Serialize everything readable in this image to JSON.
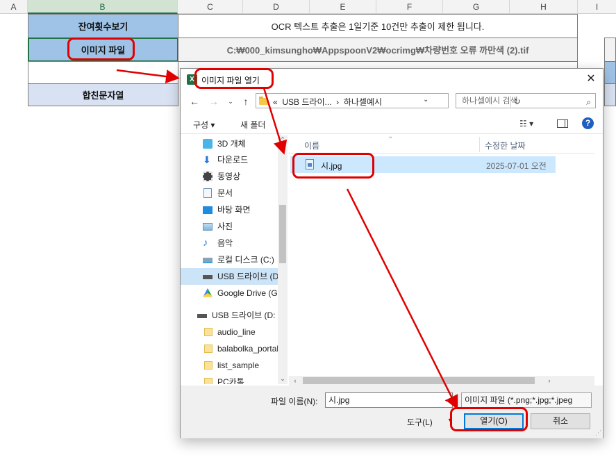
{
  "sheet": {
    "columns": [
      "A",
      "B",
      "C",
      "D",
      "E",
      "F",
      "G",
      "H",
      "I"
    ],
    "selected_column": "B",
    "rows": {
      "r1_label": "잔여횟수보기",
      "r1_value": "OCR 텍스트 추출은 1일기준 10건만 추출이 제한 됩니다.",
      "r2_label": "이미지 파일",
      "r2_value": "C:₩000_kimsungho₩AppspoonV2₩ocrimg₩차량번호 오류 까만색 (2).tif",
      "r4_label": "합친문자열"
    }
  },
  "dialog": {
    "title": "이미지 파일 열기",
    "app_icon": "excel-icon",
    "address": {
      "prefix": "«",
      "crumb_1": "USB 드라이...",
      "separator": "›",
      "crumb_2": "하나셀예시"
    },
    "search_placeholder": "하나셀예시 검색",
    "toolbar": {
      "organize": "구성 ▾",
      "new_folder": "새 폴더"
    },
    "nav_items": [
      {
        "label": "3D 개체",
        "icon": "cube-icon"
      },
      {
        "label": "다운로드",
        "icon": "download-icon"
      },
      {
        "label": "동영상",
        "icon": "video-icon"
      },
      {
        "label": "문서",
        "icon": "document-icon"
      },
      {
        "label": "바탕 화면",
        "icon": "desktop-icon"
      },
      {
        "label": "사진",
        "icon": "picture-icon"
      },
      {
        "label": "음악",
        "icon": "music-icon"
      },
      {
        "label": "로컬 디스크 (C:)",
        "icon": "disk-icon"
      },
      {
        "label": "USB 드라이브 (D",
        "icon": "usb-drive-icon",
        "selected": true
      },
      {
        "label": "Google Drive (G",
        "icon": "google-drive-icon"
      },
      {
        "label": "USB 드라이브 (D:",
        "icon": "usb-drive-icon"
      },
      {
        "label": "audio_line",
        "icon": "folder-icon"
      },
      {
        "label": "balabolka_portal",
        "icon": "folder-icon"
      },
      {
        "label": "list_sample",
        "icon": "folder-icon"
      },
      {
        "label": "PC카톡",
        "icon": "folder-icon"
      }
    ],
    "columns": {
      "name": "이름",
      "modified": "수정한 날짜"
    },
    "files": [
      {
        "name": "시.jpg",
        "modified": "2025-07-01 오전",
        "selected": true
      }
    ],
    "filename_label": "파일 이름(N):",
    "filename_value": "시.jpg",
    "filter": "이미지 파일 (*.png;*.jpg;*.jpeg",
    "tools_label": "도구(L)",
    "open_button": "열기(O)",
    "cancel_button": "취소"
  },
  "colors": {
    "annotation": "#e00000",
    "label_fill": "#9fc3e7",
    "label_fill_light": "#d9e2f3",
    "selection": "#cce8ff",
    "excel_green": "#217346",
    "accent": "#0078d7"
  }
}
